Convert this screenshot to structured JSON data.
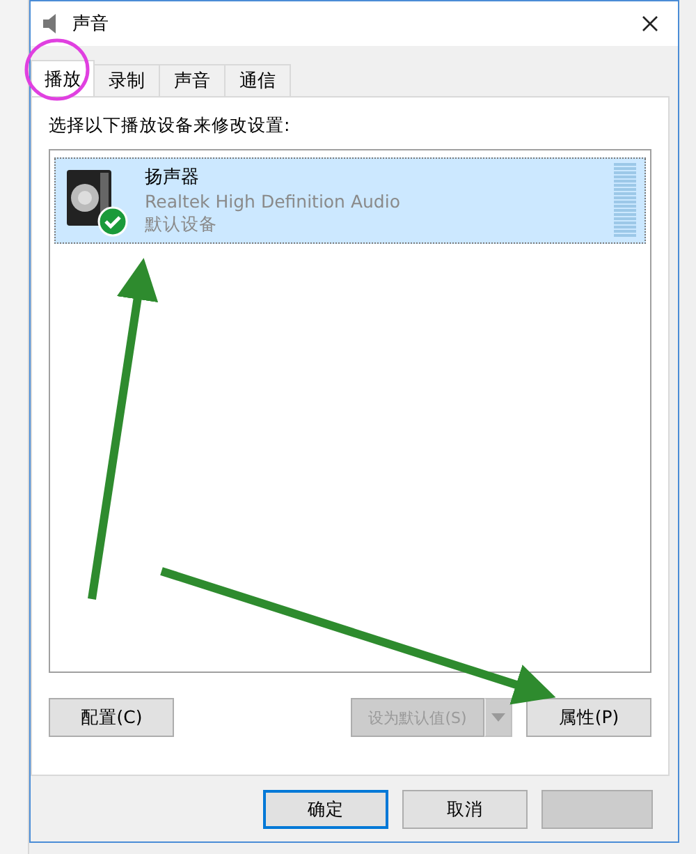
{
  "window": {
    "title": "声音"
  },
  "tabs": [
    {
      "label": "播放",
      "selected": true
    },
    {
      "label": "录制",
      "selected": false
    },
    {
      "label": "声音",
      "selected": false
    },
    {
      "label": "通信",
      "selected": false
    }
  ],
  "instruction": "选择以下播放设备来修改设置:",
  "devices": [
    {
      "name": "扬声器",
      "driver": "Realtek High Definition Audio",
      "status": "默认设备",
      "selected": true,
      "is_default": true
    }
  ],
  "device_buttons": [
    {
      "kind": "plain",
      "label": "配置(C)",
      "disabled": false
    },
    {
      "kind": "split",
      "label": "设为默认值(S)",
      "disabled": true
    },
    {
      "kind": "plain",
      "label": "属性(P)",
      "disabled": false
    }
  ],
  "dialog_buttons": [
    {
      "label": "确定",
      "focused": true
    },
    {
      "label": "取消",
      "focused": false
    }
  ]
}
